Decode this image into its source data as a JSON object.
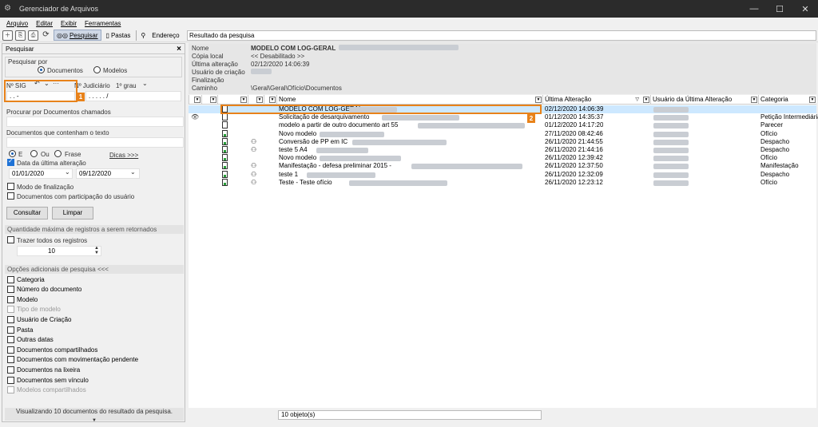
{
  "window": {
    "title": "Gerenciador de Arquivos",
    "controls": [
      "—",
      "☐",
      "✕"
    ]
  },
  "menu": [
    "Arquivo",
    "Editar",
    "Exibir",
    "Ferramentas"
  ],
  "toolbar": {
    "search_label": "Pesquisar",
    "folders_label": "Pastas",
    "address_label": "Endereço",
    "address_value": "Resultado da pesquisa"
  },
  "search_panel": {
    "title": "Pesquisar",
    "search_by_label": "Pesquisar por",
    "documents_option": "Documentos",
    "models_option": "Modelos",
    "sig_label": "Nº SIG",
    "sig_mask": ". . -",
    "judicial_label": "Nº Judiciário",
    "grade_label": "1º grau",
    "judicial_mask": ". . . . . /",
    "search_called_label": "Procurar por Documentos chamados",
    "contains_text_label": "Documentos que contenham o texto",
    "op_and": "E",
    "op_or": "Ou",
    "op_phrase": "Frase",
    "tips_link": "Dicas >>>",
    "last_change_label": "Data da última alteração",
    "date_from": "01/01/2020",
    "date_to": "09/12/2020",
    "finalization_label": "Modo de finalização",
    "participation_label": "Documentos com participação do usuário",
    "consult_button": "Consultar",
    "clear_button": "Limpar",
    "max_records_section": "Quantidade máxima de registros a serem retornados",
    "bring_all_label": "Trazer todos os registros",
    "max_records_value": "10",
    "additional_options_section": "Opções adicionais de pesquisa <<<",
    "options": [
      {
        "label": "Categoria",
        "disabled": false
      },
      {
        "label": "Número do documento",
        "disabled": false
      },
      {
        "label": "Modelo",
        "disabled": false
      },
      {
        "label": "Tipo de modelo",
        "disabled": true
      },
      {
        "label": "Usuário de Criação",
        "disabled": false
      },
      {
        "label": "Pasta",
        "disabled": false
      },
      {
        "label": "Outras datas",
        "disabled": false
      },
      {
        "label": "Documentos compartilhados",
        "disabled": false
      },
      {
        "label": "Documentos com movimentação pendente",
        "disabled": false
      },
      {
        "label": "Documentos na lixeira",
        "disabled": false
      },
      {
        "label": "Documentos sem vínculo",
        "disabled": false
      },
      {
        "label": "Modelos compartilhados",
        "disabled": true
      }
    ],
    "footer_text": "Visualizando 10 documentos do resultado da pesquisa.",
    "callout_1": "1"
  },
  "properties": {
    "name_label": "Nome",
    "name_value": "MODELO COM LOG-GERAL",
    "local_copy_label": "Cópia local",
    "local_copy_value": "<< Desabilitado >>",
    "last_change_label": "Última alteração",
    "last_change_value": "02/12/2020 14:06:39",
    "creator_label": "Usuário de criação",
    "finalization_label": "Finalização",
    "path_label": "Caminho",
    "path_value": "\\Geral\\Geral\\Ofício\\Documentos"
  },
  "columns": {
    "name": "Nome",
    "last_change": "Última Alteração",
    "last_user": "Usuário da Última Alteração",
    "category": "Categoria"
  },
  "rows": [
    {
      "name": "MODELO COM LOG-GERAL",
      "date": "02/12/2020 14:06:39",
      "category": "",
      "selected": true,
      "seal": false,
      "eye": false,
      "lock": false
    },
    {
      "name": "Solicitação de desarquivamento",
      "date": "01/12/2020 14:35:37",
      "category": "Petição Intermediária",
      "selected": false,
      "seal": false,
      "eye": true,
      "lock": false
    },
    {
      "name": "modelo a partir de outro documento art 55",
      "date": "01/12/2020 14:17:20",
      "category": "Parecer",
      "selected": false,
      "seal": false,
      "eye": false,
      "lock": false
    },
    {
      "name": "Novo modelo",
      "date": "27/11/2020 08:42:46",
      "category": "Ofício",
      "selected": false,
      "seal": false,
      "eye": false,
      "lock": true
    },
    {
      "name": "Conversão de PP em IC",
      "date": "26/11/2020 21:44:55",
      "category": "Despacho",
      "selected": false,
      "seal": true,
      "eye": false,
      "lock": true
    },
    {
      "name": "teste 5 A4",
      "date": "26/11/2020 21:44:16",
      "category": "Despacho",
      "selected": false,
      "seal": true,
      "eye": false,
      "lock": true
    },
    {
      "name": "Novo modelo",
      "date": "26/11/2020 12:39:42",
      "category": "Ofício",
      "selected": false,
      "seal": false,
      "eye": false,
      "lock": true
    },
    {
      "name": "Manifestação - defesa preliminar 2015 -",
      "date": "26/11/2020 12:37:50",
      "category": "Manifestação",
      "selected": false,
      "seal": true,
      "eye": false,
      "lock": true
    },
    {
      "name": "teste 1",
      "date": "26/11/2020 12:32:09",
      "category": "Despacho",
      "selected": false,
      "seal": true,
      "eye": false,
      "lock": true
    },
    {
      "name": "Teste - Teste ofício",
      "date": "26/11/2020 12:23:12",
      "category": "Ofício",
      "selected": false,
      "seal": true,
      "eye": false,
      "lock": true
    }
  ],
  "status": {
    "count_text": "10 objeto(s)",
    "callout_2": "2"
  }
}
